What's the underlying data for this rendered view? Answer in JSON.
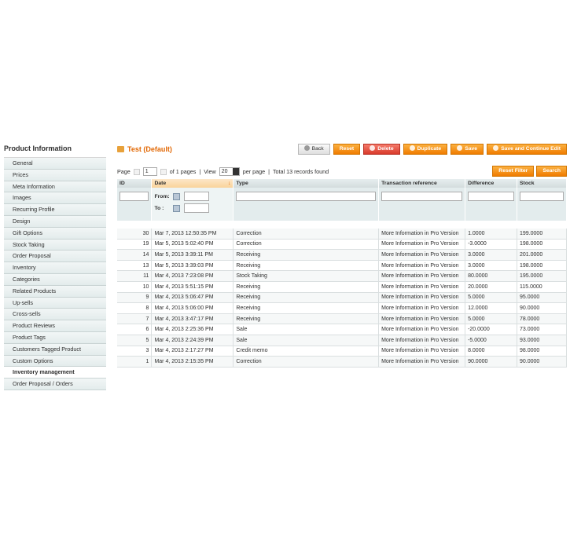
{
  "sidebar": {
    "title": "Product Information",
    "items": [
      {
        "label": "General"
      },
      {
        "label": "Prices"
      },
      {
        "label": "Meta Information"
      },
      {
        "label": "Images"
      },
      {
        "label": "Recurring Profile"
      },
      {
        "label": "Design"
      },
      {
        "label": "Gift Options"
      },
      {
        "label": "Stock Taking"
      },
      {
        "label": "Order Proposal"
      },
      {
        "label": "Inventory"
      },
      {
        "label": "Categories"
      },
      {
        "label": "Related Products"
      },
      {
        "label": "Up-sells"
      },
      {
        "label": "Cross-sells"
      },
      {
        "label": "Product Reviews"
      },
      {
        "label": "Product Tags"
      },
      {
        "label": "Customers Tagged Product"
      },
      {
        "label": "Custom Options"
      },
      {
        "label": "Inventory management"
      },
      {
        "label": "Order Proposal / Orders"
      }
    ],
    "active_index": 18
  },
  "header": {
    "title": "Test (Default)",
    "buttons": {
      "back": "Back",
      "reset": "Reset",
      "delete": "Delete",
      "duplicate": "Duplicate",
      "save": "Save",
      "save_continue": "Save and Continue Edit"
    }
  },
  "pager": {
    "page_label": "Page",
    "page_value": "1",
    "of_pages": "of 1 pages",
    "view_label": "View",
    "view_value": "20",
    "per_page": "per page",
    "total": "Total 13 records found",
    "reset_filter": "Reset Filter",
    "search": "Search"
  },
  "grid": {
    "columns": {
      "id": "ID",
      "date": "Date",
      "type": "Type",
      "ref": "Transaction reference",
      "diff": "Difference",
      "stock": "Stock"
    },
    "filter": {
      "from": "From:",
      "to": "To :"
    },
    "rows": [
      {
        "id": "30",
        "date": "Mar 7, 2013 12:50:35 PM",
        "type": "Correction",
        "ref": "More Information in Pro Version",
        "diff": "1.0000",
        "stock": "199.0000"
      },
      {
        "id": "19",
        "date": "Mar 5, 2013 5:02:40 PM",
        "type": "Correction",
        "ref": "More Information in Pro Version",
        "diff": "-3.0000",
        "stock": "198.0000"
      },
      {
        "id": "14",
        "date": "Mar 5, 2013 3:39:11 PM",
        "type": "Receiving",
        "ref": "More Information in Pro Version",
        "diff": "3.0000",
        "stock": "201.0000"
      },
      {
        "id": "13",
        "date": "Mar 5, 2013 3:39:03 PM",
        "type": "Receiving",
        "ref": "More Information in Pro Version",
        "diff": "3.0000",
        "stock": "198.0000"
      },
      {
        "id": "11",
        "date": "Mar 4, 2013 7:23:08 PM",
        "type": "Stock Taking",
        "ref": "More Information in Pro Version",
        "diff": "80.0000",
        "stock": "195.0000"
      },
      {
        "id": "10",
        "date": "Mar 4, 2013 5:51:15 PM",
        "type": "Receiving",
        "ref": "More Information in Pro Version",
        "diff": "20.0000",
        "stock": "115.0000"
      },
      {
        "id": "9",
        "date": "Mar 4, 2013 5:06:47 PM",
        "type": "Receiving",
        "ref": "More Information in Pro Version",
        "diff": "5.0000",
        "stock": "95.0000"
      },
      {
        "id": "8",
        "date": "Mar 4, 2013 5:06:00 PM",
        "type": "Receiving",
        "ref": "More Information in Pro Version",
        "diff": "12.0000",
        "stock": "90.0000"
      },
      {
        "id": "7",
        "date": "Mar 4, 2013 3:47:17 PM",
        "type": "Receiving",
        "ref": "More Information in Pro Version",
        "diff": "5.0000",
        "stock": "78.0000"
      },
      {
        "id": "6",
        "date": "Mar 4, 2013 2:25:36 PM",
        "type": "Sale",
        "ref": "More Information in Pro Version",
        "diff": "-20.0000",
        "stock": "73.0000"
      },
      {
        "id": "5",
        "date": "Mar 4, 2013 2:24:39 PM",
        "type": "Sale",
        "ref": "More Information in Pro Version",
        "diff": "-5.0000",
        "stock": "93.0000"
      },
      {
        "id": "3",
        "date": "Mar 4, 2013 2:17:27 PM",
        "type": "Credit memo",
        "ref": "More Information in Pro Version",
        "diff": "8.0000",
        "stock": "98.0000"
      },
      {
        "id": "1",
        "date": "Mar 4, 2013 2:15:35 PM",
        "type": "Correction",
        "ref": "More Information in Pro Version",
        "diff": "90.0000",
        "stock": "90.0000"
      }
    ]
  }
}
